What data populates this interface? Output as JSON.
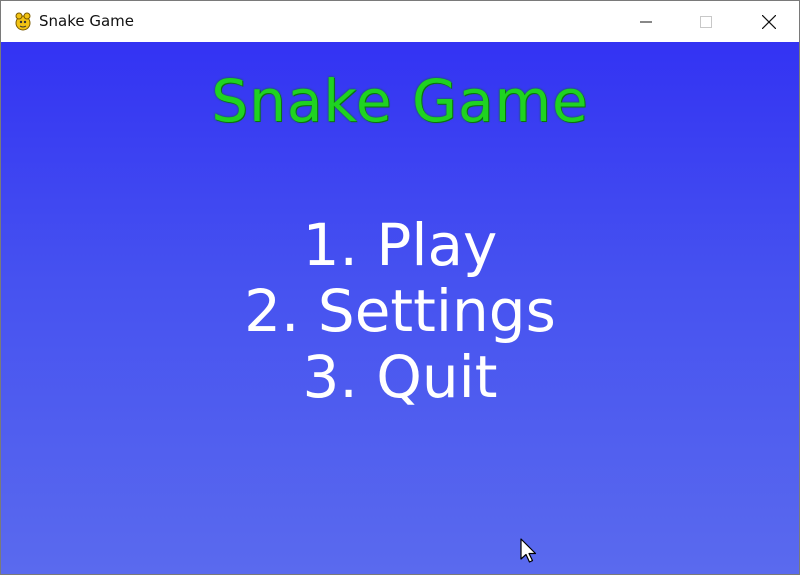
{
  "window": {
    "title": "Snake Game",
    "icon": "pygame-snake-icon",
    "controls": [
      "minimize",
      "maximize",
      "close"
    ]
  },
  "game": {
    "title": "Snake Game",
    "menu": [
      {
        "label": "1. Play"
      },
      {
        "label": "2. Settings"
      },
      {
        "label": "3. Quit"
      }
    ]
  },
  "colors": {
    "background_top": "#3333f3",
    "background_bottom": "#5a6aee",
    "title_text": "#1fd321",
    "menu_text": "#ffffff"
  }
}
